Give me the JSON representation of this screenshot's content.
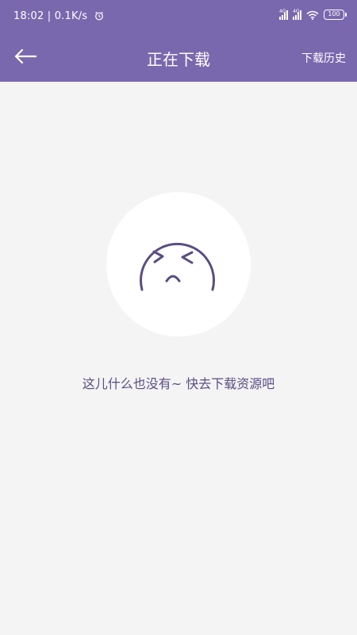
{
  "status_bar": {
    "time": "18:02 | 0.1K/s",
    "network_label_1": "4G",
    "network_label_2": "4G",
    "battery": "100"
  },
  "header": {
    "title": "正在下载",
    "history_label": "下载历史"
  },
  "empty_state": {
    "message": "这儿什么也没有~ 快去下载资源吧",
    "icon": "sad-face-icon"
  },
  "colors": {
    "header_bg": "#7a68ae",
    "page_bg": "#f4f4f4",
    "accent": "#5a4d84"
  }
}
